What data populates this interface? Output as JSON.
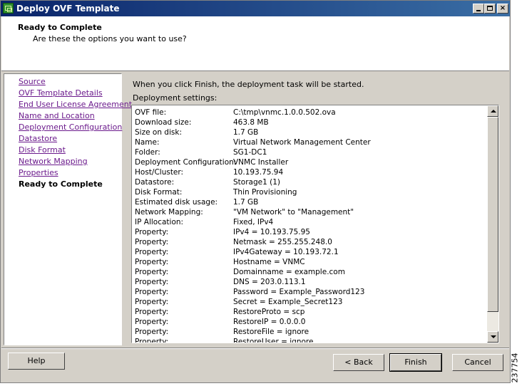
{
  "window": {
    "title": "Deploy OVF Template",
    "controls": {
      "minimize": "_",
      "maximize": "□",
      "close": "×"
    }
  },
  "header": {
    "title": "Ready to Complete",
    "subtitle": "Are these the options you want to use?"
  },
  "nav": {
    "items": [
      {
        "label": "Source"
      },
      {
        "label": "OVF Template Details"
      },
      {
        "label": "End User License Agreement"
      },
      {
        "label": "Name and Location"
      },
      {
        "label": "Deployment Configuration"
      },
      {
        "label": "Datastore"
      },
      {
        "label": "Disk Format"
      },
      {
        "label": "Network Mapping"
      },
      {
        "label": "Properties"
      },
      {
        "label": "Ready to Complete"
      }
    ]
  },
  "main": {
    "intro": "When you click Finish, the deployment task will be started.",
    "settings_label": "Deployment settings:",
    "settings": [
      {
        "key": "OVF file:",
        "value": "C:\\tmp\\vnmc.1.0.0.502.ova"
      },
      {
        "key": "Download size:",
        "value": "463.8 MB"
      },
      {
        "key": "Size on disk:",
        "value": "1.7 GB"
      },
      {
        "key": "Name:",
        "value": "Virtual Network Management Center"
      },
      {
        "key": "Folder:",
        "value": "SG1-DC1"
      },
      {
        "key": "Deployment Configuration:",
        "value": "VNMC Installer"
      },
      {
        "key": "Host/Cluster:",
        "value": "10.193.75.94"
      },
      {
        "key": "Datastore:",
        "value": "Storage1 (1)"
      },
      {
        "key": "Disk Format:",
        "value": "Thin Provisioning"
      },
      {
        "key": "Estimated disk usage:",
        "value": "1.7 GB"
      },
      {
        "key": "Network Mapping:",
        "value": "\"VM Network\" to \"Management\""
      },
      {
        "key": "IP Allocation:",
        "value": "Fixed, IPv4"
      },
      {
        "key": "Property:",
        "value": "IPv4 = 10.193.75.95"
      },
      {
        "key": "Property:",
        "value": "Netmask = 255.255.248.0"
      },
      {
        "key": "Property:",
        "value": "IPv4Gateway = 10.193.72.1"
      },
      {
        "key": "Property:",
        "value": "Hostname = VNMC"
      },
      {
        "key": "Property:",
        "value": "Domainname = example.com"
      },
      {
        "key": "Property:",
        "value": "DNS = 203.0.113.1"
      },
      {
        "key": "Property:",
        "value": "Password = Example_Password123"
      },
      {
        "key": "Property:",
        "value": "Secret = Example_Secret123"
      },
      {
        "key": "Property:",
        "value": "RestoreProto = scp"
      },
      {
        "key": "Property:",
        "value": "RestoreIP = 0.0.0.0"
      },
      {
        "key": "Property:",
        "value": "RestoreFile = ignore"
      },
      {
        "key": "Property:",
        "value": "RestoreUser = ignore"
      }
    ]
  },
  "buttons": {
    "help": "Help",
    "back": "< Back",
    "finish": "Finish",
    "cancel": "Cancel"
  },
  "figure_id": "237754"
}
